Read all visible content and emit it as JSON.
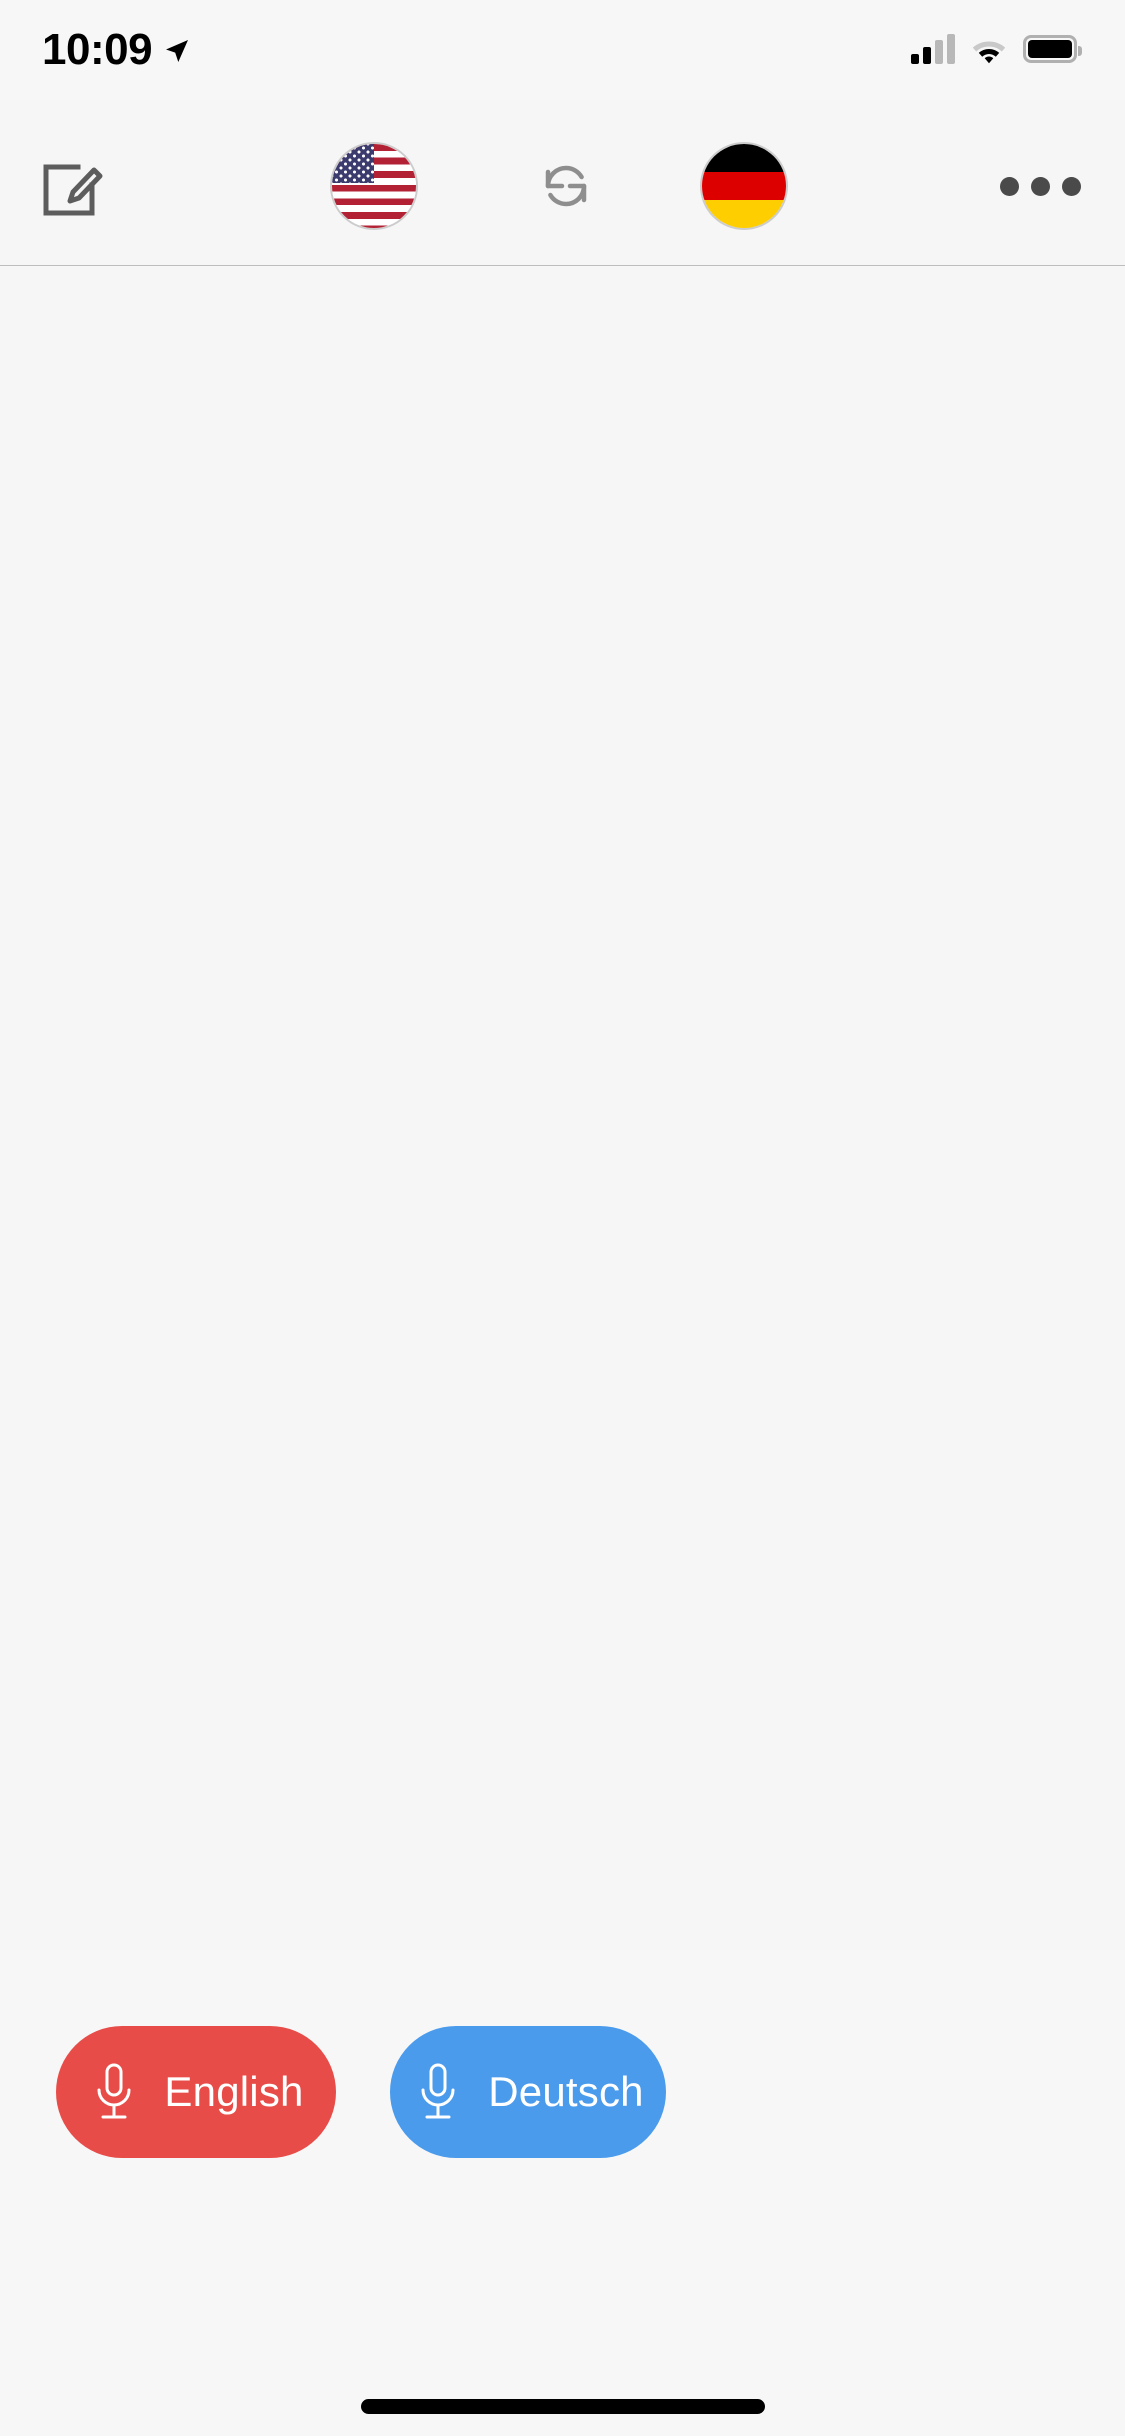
{
  "status_bar": {
    "time": "10:09",
    "location_icon": "location-arrow-icon",
    "cellular_icon": "cellular-signal-icon",
    "wifi_icon": "wifi-icon",
    "battery_icon": "battery-icon"
  },
  "toolbar": {
    "compose_label": "compose-icon",
    "source_flag": {
      "name": "united-states-flag",
      "colors": [
        "#b22234",
        "#ffffff",
        "#3c3b6e"
      ]
    },
    "swap_label": "swap-languages-icon",
    "target_flag": {
      "name": "germany-flag",
      "colors": [
        "#000000",
        "#dd0000",
        "#ffce00"
      ]
    },
    "more_label": "more-options-icon"
  },
  "content": {
    "transcript": []
  },
  "mic_buttons": [
    {
      "id": "source",
      "label": "English",
      "icon": "microphone-icon",
      "color": "#e84c48",
      "text_color": "#ffffff"
    },
    {
      "id": "target",
      "label": "Deutsch",
      "icon": "microphone-icon",
      "color": "#4a9bec",
      "text_color": "#ffffff"
    }
  ],
  "home_indicator": {
    "name": "home-indicator",
    "color": "#000000"
  },
  "theme": {
    "background": "#f6f6f6",
    "separator": "#bdbdbd",
    "icon_gray": "#8e8e8e"
  }
}
